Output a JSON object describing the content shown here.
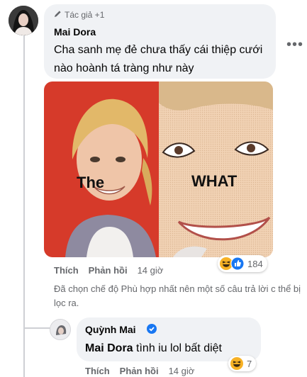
{
  "comment": {
    "author_badge": "Tác giả +1",
    "author": "Mai Dora",
    "text": "Cha sanh mẹ đẻ chưa thấy cái thiệp cưới nào hoành tá tràng như này",
    "meme": {
      "left_caption": "The",
      "right_caption": "WHAT"
    },
    "actions": {
      "like": "Thích",
      "reply": "Phản hồi",
      "time": "14 giờ"
    },
    "reactions": {
      "icons": [
        "haha-icon",
        "like-icon"
      ],
      "count": "184"
    },
    "filter_note": "Đã chọn chế độ Phù hợp nhất nên một số câu trả lời c thể bị lọc ra."
  },
  "reply": {
    "author": "Quỳnh Mai",
    "mention": "Mai Dora",
    "text": " tình iu lol bất diệt",
    "actions": {
      "like": "Thích",
      "reply": "Phản hồi",
      "time": "14 giờ"
    },
    "reactions": {
      "icons": [
        "haha-icon"
      ],
      "count": "7"
    }
  },
  "colors": {
    "bubble": "#f0f2f5",
    "meta": "#65676b",
    "verified": "#1877f2",
    "like": "#1877f2",
    "haha": "#f7b125"
  }
}
